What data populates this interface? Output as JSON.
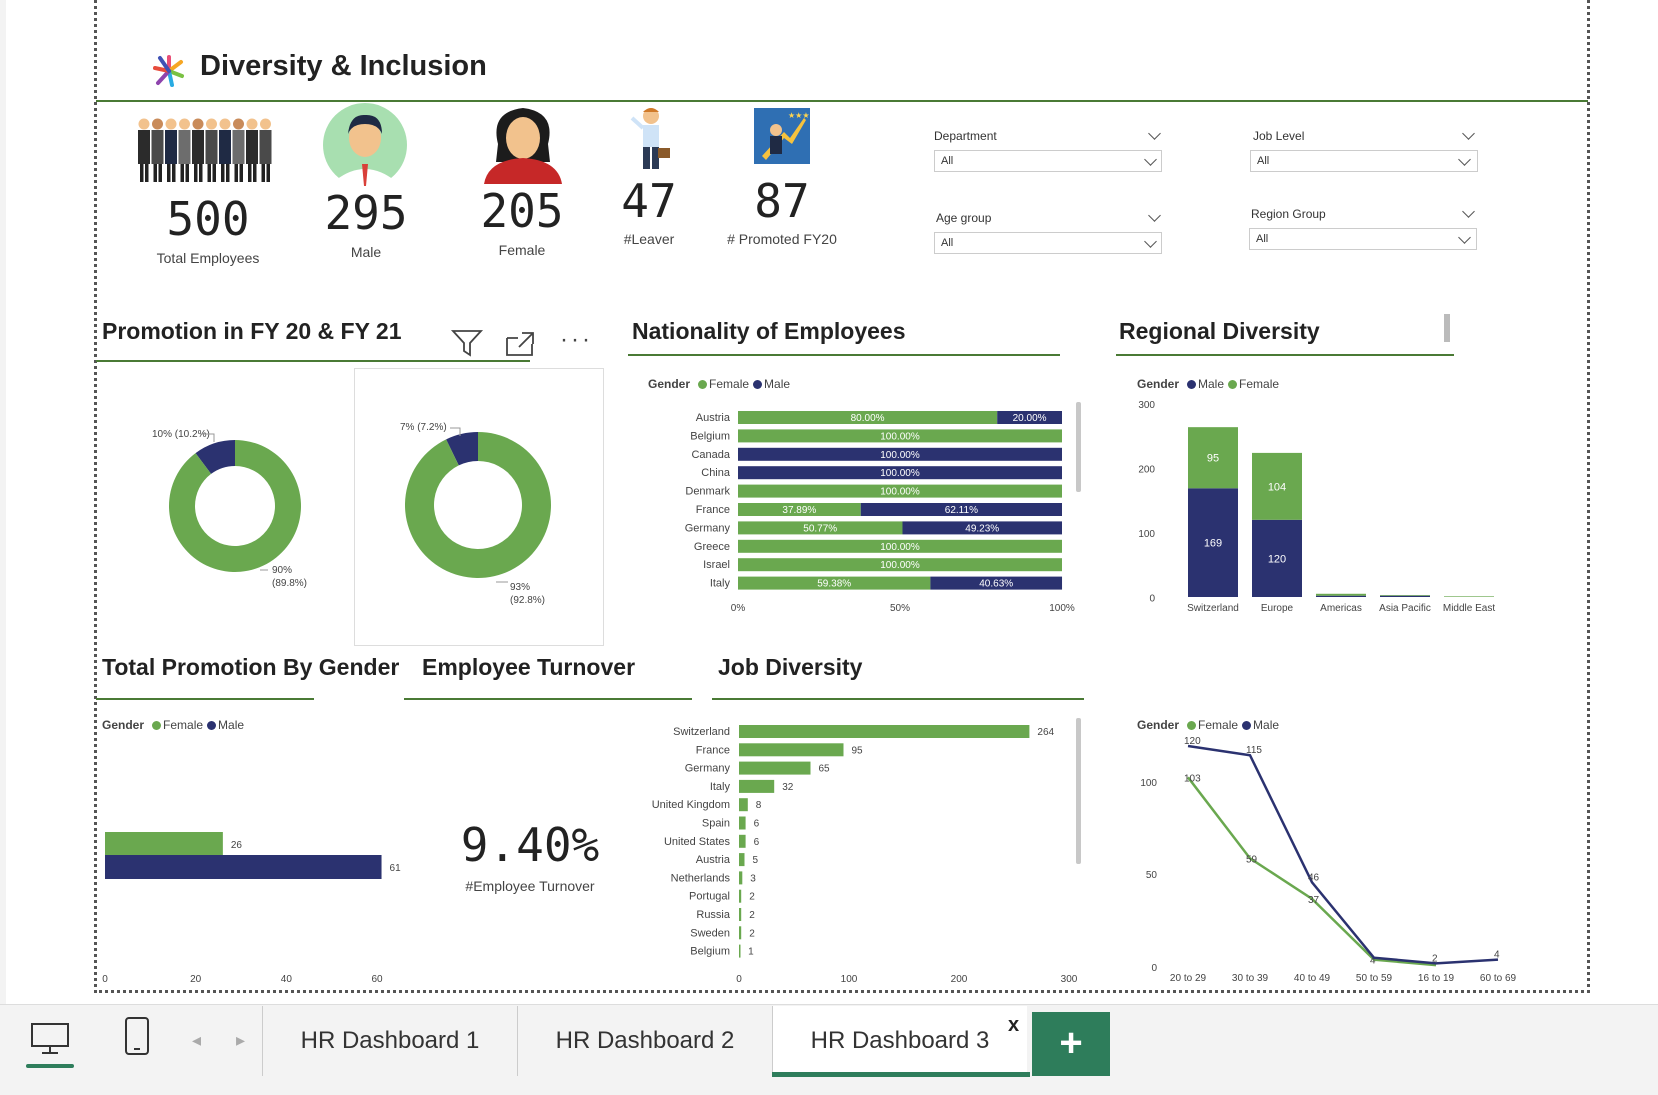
{
  "report": {
    "title": "Diversity & Inclusion",
    "kpis": [
      {
        "value": "500",
        "label": "Total Employees"
      },
      {
        "value": "295",
        "label": "Male"
      },
      {
        "value": "205",
        "label": "Female"
      },
      {
        "value": "47",
        "label": "#Leaver"
      },
      {
        "value": "87",
        "label": "# Promoted FY20"
      }
    ],
    "slicers": [
      {
        "label": "Department",
        "value": "All"
      },
      {
        "label": "Job Level",
        "value": "All"
      },
      {
        "label": "Age group",
        "value": "All"
      },
      {
        "label": "Region Group",
        "value": "All"
      }
    ],
    "colors": {
      "female": "#6aa84f",
      "male": "#2b3270",
      "accent": "#2e7d5b"
    }
  },
  "sections": {
    "promotion": "Promotion in FY 20 & FY 21",
    "nationality": "Nationality of Employees",
    "regional": "Regional Diversity",
    "total_promotion": "Total Promotion By Gender",
    "turnover": "Employee Turnover",
    "job_diversity": "Job Diversity"
  },
  "legend": {
    "gender": "Gender",
    "female": "Female",
    "male": "Male"
  },
  "turnover": {
    "value": "9.40%",
    "label": "#Employee Turnover"
  },
  "chart_data": [
    {
      "type": "pie",
      "title": "",
      "slices": [
        {
          "label": "10% (10.2%)",
          "value": 10.2,
          "color": "#2b3270"
        },
        {
          "label": "90% (89.8%)",
          "value": 89.8,
          "color": "#6aa84f"
        }
      ]
    },
    {
      "type": "pie",
      "title": "",
      "slices": [
        {
          "label": "7% (7.2%)",
          "value": 7.2,
          "color": "#2b3270"
        },
        {
          "label": "93% (92.8%)",
          "value": 92.8,
          "color": "#6aa84f"
        }
      ]
    },
    {
      "type": "bar",
      "orientation": "horizontal-100-stacked",
      "categories": [
        "Austria",
        "Belgium",
        "Canada",
        "China",
        "Denmark",
        "France",
        "Germany",
        "Greece",
        "Israel",
        "Italy"
      ],
      "series": [
        {
          "name": "Female",
          "values": [
            80.0,
            100,
            0,
            0,
            100,
            37.89,
            50.77,
            100,
            100,
            59.38
          ],
          "labels": [
            "80.00%",
            "100.00%",
            "",
            "",
            "100.00%",
            "37.89%",
            "50.77%",
            "100.00%",
            "100.00%",
            "59.38%"
          ]
        },
        {
          "name": "Male",
          "values": [
            20.0,
            0,
            100,
            100,
            0,
            62.11,
            49.23,
            0,
            0,
            40.63
          ],
          "labels": [
            "20.00%",
            "",
            "100.00%",
            "100.00%",
            "",
            "62.11%",
            "49.23%",
            "",
            "",
            "40.63%"
          ]
        }
      ],
      "xticks": [
        "0%",
        "50%",
        "100%"
      ]
    },
    {
      "type": "bar",
      "orientation": "vertical-stacked",
      "categories": [
        "Switzerland",
        "Europe",
        "Americas",
        "Asia Pacific",
        "Middle East"
      ],
      "series": [
        {
          "name": "Male",
          "values": [
            169,
            120,
            2,
            2,
            0
          ]
        },
        {
          "name": "Female",
          "values": [
            95,
            104,
            3,
            1,
            1
          ]
        }
      ],
      "ylim": [
        0,
        300
      ],
      "yticks": [
        "300",
        "200",
        "100",
        "0"
      ]
    },
    {
      "type": "bar",
      "orientation": "horizontal",
      "categories": [
        "Female",
        "Male"
      ],
      "series": [
        {
          "name": "Female",
          "values": [
            26
          ]
        },
        {
          "name": "Male",
          "values": [
            61
          ]
        }
      ],
      "xlim": [
        0,
        60
      ],
      "xticks": [
        "0",
        "20",
        "40",
        "60"
      ]
    },
    {
      "type": "bar",
      "orientation": "horizontal",
      "categories": [
        "Switzerland",
        "France",
        "Germany",
        "Italy",
        "United Kingdom",
        "Spain",
        "United States",
        "Austria",
        "Netherlands",
        "Portugal",
        "Russia",
        "Sweden",
        "Belgium"
      ],
      "values": [
        264,
        95,
        65,
        32,
        8,
        6,
        6,
        5,
        3,
        2,
        2,
        2,
        1
      ],
      "xlim": [
        0,
        300
      ],
      "xticks": [
        "0",
        "100",
        "200",
        "300"
      ]
    },
    {
      "type": "line",
      "x": [
        "20 to 29",
        "30 to 39",
        "40 to 49",
        "50 to 59",
        "16 to 19",
        "60 to 69"
      ],
      "series": [
        {
          "name": "Female",
          "values": [
            103,
            59,
            37,
            4,
            1,
            null
          ],
          "labels": [
            "103",
            "59",
            "37",
            "4",
            "",
            ""
          ]
        },
        {
          "name": "Male",
          "values": [
            120,
            115,
            46,
            5,
            2,
            4
          ],
          "labels": [
            "120",
            "115",
            "46",
            "",
            "2",
            "4"
          ]
        }
      ],
      "ylim": [
        0,
        120
      ],
      "yticks": [
        "100",
        "50",
        "0"
      ]
    }
  ],
  "tabs": {
    "t1": "HR Dashboard 1",
    "t2": "HR Dashboard 2",
    "t3": "HR Dashboard 3",
    "close": "x",
    "add": "+"
  }
}
